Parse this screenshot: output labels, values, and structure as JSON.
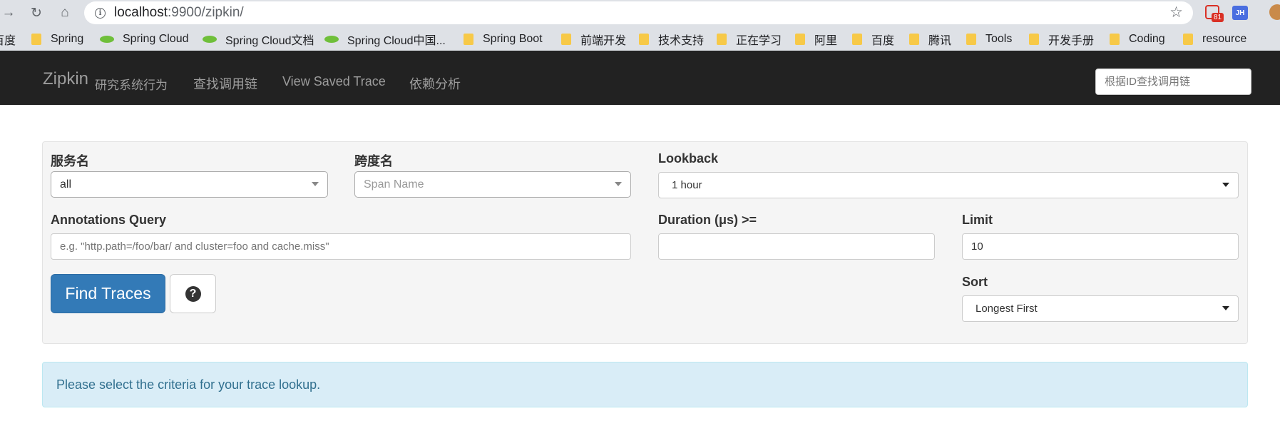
{
  "browser": {
    "url_host": "localhost",
    "url_rest": ":9900/zipkin/",
    "extension_badge": "81",
    "extension_jh": "JH"
  },
  "bookmarks": [
    {
      "label": "百度",
      "icon": "folder-icon"
    },
    {
      "label": "Spring",
      "icon": "folder-icon"
    },
    {
      "label": "Spring Cloud",
      "icon": "leaf-icon"
    },
    {
      "label": "Spring Cloud文档",
      "icon": "leaf-icon"
    },
    {
      "label": "Spring Cloud中国...",
      "icon": "leaf-icon"
    },
    {
      "label": "Spring Boot",
      "icon": "folder-icon"
    },
    {
      "label": "前端开发",
      "icon": "folder-icon"
    },
    {
      "label": "技术支持",
      "icon": "folder-icon"
    },
    {
      "label": "正在学习",
      "icon": "folder-icon"
    },
    {
      "label": "阿里",
      "icon": "folder-icon"
    },
    {
      "label": "百度",
      "icon": "folder-icon"
    },
    {
      "label": "腾讯",
      "icon": "folder-icon"
    },
    {
      "label": "Tools",
      "icon": "folder-icon"
    },
    {
      "label": "开发手册",
      "icon": "folder-icon"
    },
    {
      "label": "Coding",
      "icon": "folder-icon"
    },
    {
      "label": "resource",
      "icon": "folder-icon"
    }
  ],
  "navbar": {
    "brand": "Zipkin",
    "brand_sub": "研究系统行为",
    "links": [
      "查找调用链",
      "View Saved Trace",
      "依赖分析"
    ],
    "search_placeholder": "根据ID查找调用链"
  },
  "search": {
    "service_label": "服务名",
    "service_value": "all",
    "span_label": "跨度名",
    "span_placeholder": "Span Name",
    "lookback_label": "Lookback",
    "lookback_value": "1 hour",
    "annotations_label": "Annotations Query",
    "annotations_placeholder": "e.g. \"http.path=/foo/bar/ and cluster=foo and cache.miss\"",
    "duration_label": "Duration (μs) >=",
    "duration_value": "",
    "limit_label": "Limit",
    "limit_value": "10",
    "sort_label": "Sort",
    "sort_value": "Longest First",
    "find_button": "Find Traces",
    "help_icon": "question-circle-icon"
  },
  "alert": {
    "message": "Please select the criteria for your trace lookup."
  },
  "colors": {
    "navbar_bg": "#222222",
    "primary_button": "#337ab7",
    "alert_bg": "#d9edf7",
    "alert_text": "#31708f"
  }
}
